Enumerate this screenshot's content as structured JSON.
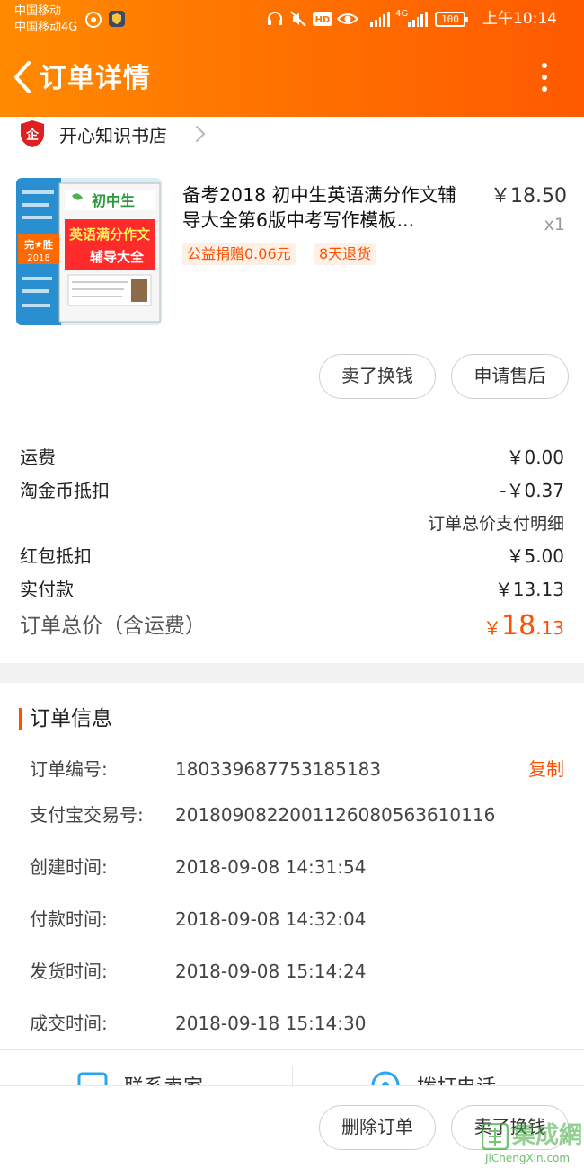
{
  "status_bar": {
    "carrier_1": "中国移动",
    "carrier_2": "中国移动4G",
    "network_label": "4G",
    "battery": "100",
    "time": "上午10:14",
    "icons": [
      "hotspot-icon",
      "shield-app-icon",
      "headset-icon",
      "mute-icon",
      "hd-icon",
      "eye-icon",
      "signal-icon",
      "battery-icon"
    ]
  },
  "nav": {
    "title": "订单详情"
  },
  "shop": {
    "name": "开心知识书店",
    "badge": "企"
  },
  "product": {
    "title": "备考2018 初中生英语满分作文辅导大全第6版中考写作模板...",
    "price": "￥18.50",
    "quantity": "x1",
    "tags": [
      "公益捐赠0.06元",
      "8天退货"
    ],
    "cover": {
      "series": "初中生",
      "main_title_1": "英语满分作文",
      "main_title_2": "辅导大全",
      "badge": "完★胜",
      "year": "2018"
    }
  },
  "actions": {
    "sell_for_cash": "卖了换钱",
    "after_sales": "申请售后"
  },
  "summary": {
    "shipping_label": "运费",
    "shipping_value": "￥0.00",
    "coin_label": "淘金币抵扣",
    "coin_value": "-￥0.37",
    "detail_link": "订单总价支付明细",
    "redpacket_label": "红包抵扣",
    "redpacket_value": "￥5.00",
    "paid_label": "实付款",
    "paid_value": "￥13.13",
    "total_label": "订单总价（含运费）",
    "total_currency": "￥",
    "total_int": "18",
    "total_dec": ".13"
  },
  "order_info": {
    "title": "订单信息",
    "copy_label": "复制",
    "rows": [
      {
        "label": "订单编号:",
        "value": "180339687753185183"
      },
      {
        "label": "支付宝交易号:",
        "value": "2018090822001126080563610116"
      },
      {
        "label": "创建时间:",
        "value": "2018-09-08 14:31:54"
      },
      {
        "label": "付款时间:",
        "value": "2018-09-08 14:32:04"
      },
      {
        "label": "发货时间:",
        "value": "2018-09-08 15:14:24"
      },
      {
        "label": "成交时间:",
        "value": "2018-09-18 15:14:30"
      }
    ]
  },
  "contact": {
    "seller": "联系卖家",
    "call": "拨打电话"
  },
  "bottom_actions": {
    "delete_order": "删除订单",
    "sell_for_cash": "卖了换钱"
  },
  "watermark": {
    "text": "集成網",
    "url": "JiChengXin.com"
  },
  "colors": {
    "brand_orange": "#ff5000",
    "header_start": "#ff8a00",
    "header_end": "#ff5a00"
  }
}
